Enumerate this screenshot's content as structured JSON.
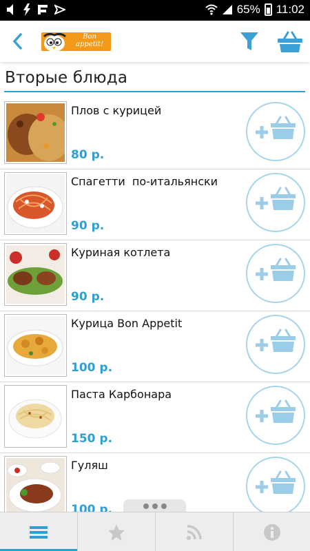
{
  "status_bar": {
    "battery": "65%",
    "time": "11:02"
  },
  "header": {
    "logo_text": "Bon appetit!",
    "back_icon": "chevron-left-icon",
    "filter_icon": "filter-icon",
    "basket_icon": "basket-icon"
  },
  "section": {
    "title": "Вторые блюда"
  },
  "items": [
    {
      "name": "Плов с курицей",
      "price": "80 р."
    },
    {
      "name": "Спагетти  по-итальянски",
      "price": "90 р."
    },
    {
      "name": "Куриная котлета",
      "price": "90 р."
    },
    {
      "name": "Курица Bon Appetit",
      "price": "100 р."
    },
    {
      "name": "Паста Карбонара",
      "price": "150 р."
    },
    {
      "name": "Гуляш",
      "price": "100 р."
    }
  ],
  "bottom_nav": {
    "tabs": [
      "menu-icon",
      "star-icon",
      "rss-icon",
      "info-icon"
    ],
    "active": "menu-icon"
  },
  "colors": {
    "accent": "#2f9fd2",
    "logo": "#f39a1b",
    "add_button": "#a5d4ec"
  }
}
